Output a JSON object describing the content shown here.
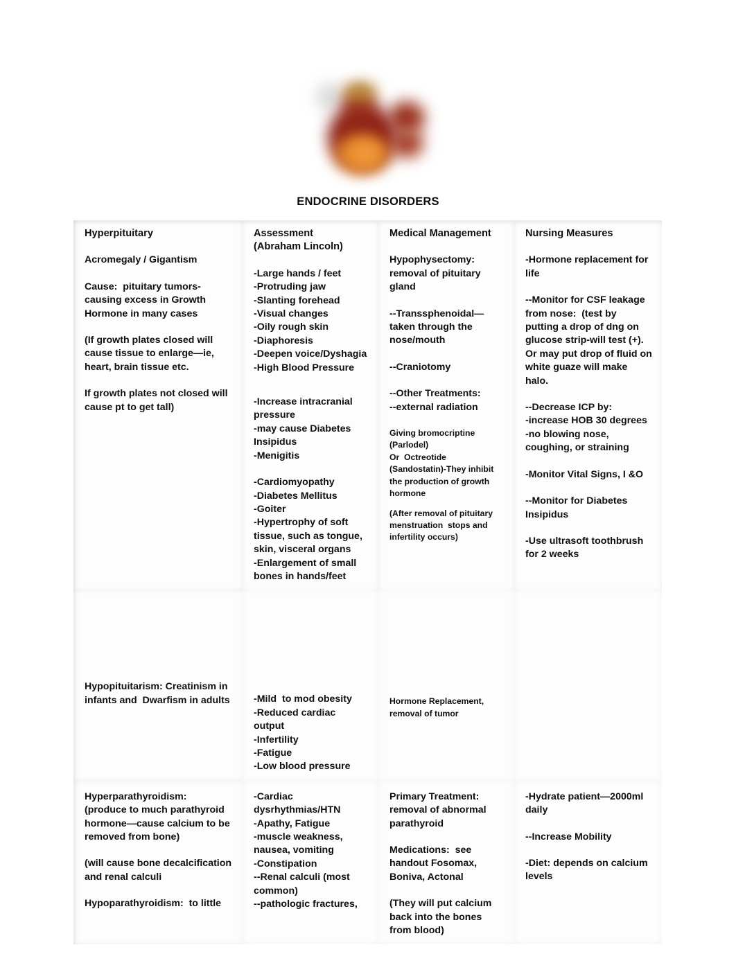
{
  "document": {
    "title": "ENDOCRINE DISORDERS",
    "header_image_name": "blurred-bottle-and-jar-photo"
  },
  "table": {
    "headers": [
      "Hyperpituitary",
      "Assessment\n(Abraham Lincoln)",
      "Medical Management",
      "Nursing Measures"
    ],
    "rows": [
      {
        "condition": {
          "title": "Acromegaly / Gigantism",
          "cause": "Cause:  pituitary tumors-causing excess in Growth Hormone in many cases",
          "note_1": "(If growth plates closed will cause tissue to enlarge—ie, heart, brain tissue etc.",
          "note_2": "If growth plates not closed will cause pt to get tall)"
        },
        "assessment": {
          "group_1": "-Large hands / feet\n-Protruding jaw\n-Slanting forehead\n-Visual changes\n-Oily rough skin\n-Diaphoresis\n-Deepen voice/Dyshagia\n-High Blood Pressure",
          "group_2": "-Increase intracranial pressure\n-may cause Diabetes Insipidus\n-Menigitis",
          "group_3": "-Cardiomyopathy\n-Diabetes Mellitus\n-Goiter\n-Hypertrophy of soft tissue, such as tongue, skin, visceral organs\n-Enlargement of small bones in hands/feet"
        },
        "medical_management": {
          "item_1": "Hypophysectomy:\nremoval of pituitary gland",
          "item_2": "--Transsphenoidal—taken through the nose/mouth",
          "item_3": "--Craniotomy",
          "item_4": "--Other Treatments:\n--external radiation",
          "item_5_small": "Giving bromocriptine (Parlodel)\nOr  Octreotide (Sandostatin)-They inhibit the production of growth hormone",
          "item_6_small": "(After removal of pituitary menstruation  stops and infertility occurs)"
        },
        "nursing_measures": {
          "item_1": "-Hormone replacement for life",
          "item_2": "--Monitor for CSF leakage from nose:  (test by putting a drop of dng on glucose strip-will test (+).   Or may put drop of fluid on white guaze will make halo.",
          "item_3": "--Decrease ICP by:\n-increase HOB 30 degrees\n-no blowing nose, coughing, or straining",
          "item_4": "-Monitor Vital Signs, I &O",
          "item_5": "--Monitor for Diabetes Insipidus",
          "item_6": "-Use ultrasoft toothbrush for 2 weeks"
        }
      },
      {
        "condition": {
          "title": "Hypopituitarism: Creatinism in infants and  Dwarfism in adults"
        },
        "assessment": {
          "group_1": "-Mild  to mod obesity\n-Reduced cardiac output\n-Infertility\n-Fatigue\n-Low blood pressure"
        },
        "medical_management": {
          "item_1_small": "Hormone Replacement, removal of tumor"
        },
        "nursing_measures": {
          "item_1": ""
        }
      },
      {
        "condition": {
          "title": "Hyperparathyroidism:\n(produce to much parathyroid hormone—cause calcium to be removed from bone)",
          "note_1": "(will cause bone decalcification and renal calculi",
          "note_2": "Hypoparathyroidism:  to little"
        },
        "assessment": {
          "group_1": "-Cardiac dysrhythmias/HTN\n-Apathy, Fatigue\n-muscle weakness, nausea, vomiting\n-Constipation\n--Renal calculi (most common)\n--pathologic fractures,"
        },
        "medical_management": {
          "item_1": "Primary Treatment:\nremoval of abnormal parathyroid",
          "item_2": "Medications:  see handout Fosomax, Boniva, Actonal",
          "item_3": "(They will put calcium back into the bones from blood)"
        },
        "nursing_measures": {
          "item_1": "-Hydrate patient—2000ml daily",
          "item_2": "--Increase Mobility",
          "item_3": "-Diet: depends on calcium levels"
        }
      }
    ]
  }
}
